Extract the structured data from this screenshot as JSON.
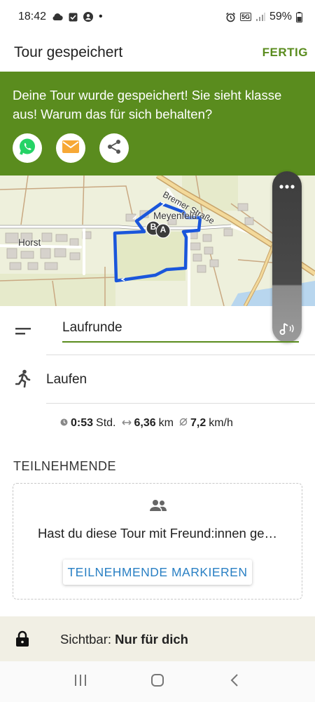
{
  "status_bar": {
    "time": "18:42",
    "dot": "•",
    "network": "5G",
    "battery": "59%"
  },
  "app_bar": {
    "title": "Tour gespeichert",
    "done_label": "FERTIG"
  },
  "banner": {
    "text": "Deine Tour wurde gespeichert! Sie sieht klasse aus! Warum das für sich behalten?",
    "share_icons": [
      "whatsapp-icon",
      "mail-icon",
      "share-icon"
    ]
  },
  "map": {
    "labels": {
      "town_1": "Horst",
      "town_2": "Meyenfeld",
      "road": "Bremer Straße"
    },
    "markers": {
      "start": "A",
      "end": "B"
    },
    "route_color": "#1a56db"
  },
  "tour": {
    "name": "Laufrunde",
    "sport": "Laufen",
    "stats": {
      "duration": "0:53",
      "duration_unit": "Std.",
      "distance": "6,36",
      "distance_unit": "km",
      "speed": "7,2",
      "speed_unit": "km/h"
    }
  },
  "participants": {
    "heading": "TEILNEHMENDE",
    "prompt": "Hast du diese Tour mit Freund:innen ge…",
    "button": "TEILNEHMENDE MARKIEREN"
  },
  "visibility": {
    "label": "Sichtbar:",
    "value": "Nur für dich"
  },
  "colors": {
    "accent": "#5a8c1e",
    "link": "#2a80c4",
    "visibility_bg": "#f1efe4"
  }
}
